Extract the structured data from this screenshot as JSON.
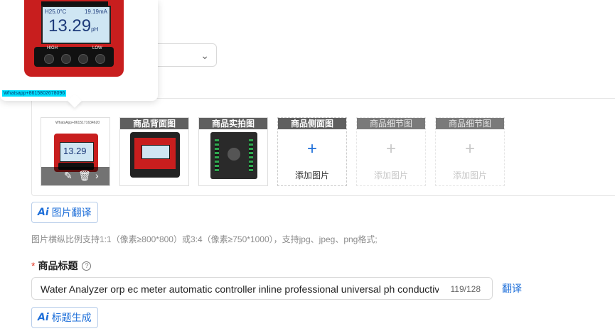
{
  "preview": {
    "reading_top": "H25.0°C",
    "reading_current": "19.19mA",
    "reading_main": "13.29",
    "reading_unit": "pH",
    "label_high": "HIGH",
    "label_low": "LOW",
    "watermark": "Whatsapp+8615802678096"
  },
  "images": {
    "main_reading": "13.29",
    "main_top_text": "WhatsApp+8615171634620",
    "tags": [
      "商品背面图",
      "商品实拍图",
      "商品侧面图",
      "商品细节图",
      "商品细节图"
    ],
    "add_label": "添加图片",
    "actions": {
      "edit": "✎",
      "delete": "🗑",
      "next": "›"
    }
  },
  "buttons": {
    "image_translate": "图片翻译",
    "title_generate": "标题生成",
    "ai_prefix": "Ai"
  },
  "hint": "图片横纵比例支持1:1（像素≥800*800）或3:4（像素≥750*1000），支持jpg、jpeg、png格式;",
  "title_field": {
    "required_mark": "*",
    "label": "商品标题",
    "help": "?",
    "value": "Water Analyzer orp ec meter automatic controller inline professional universal ph conductiv",
    "counter": "119/128",
    "translate": "翻译"
  },
  "colors": {
    "accent": "#1e6fd9",
    "device_red": "#c81e1e",
    "required": "#e0301e"
  }
}
